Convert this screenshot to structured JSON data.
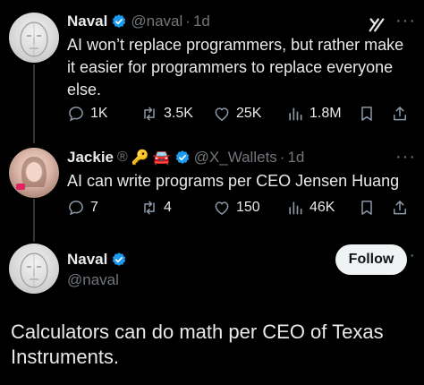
{
  "tweets": [
    {
      "name": "Naval",
      "handle": "@naval",
      "separator": "·",
      "time": "1d",
      "text": "AI won’t replace programmers, but rather make it easier for programmers to replace everyone else.",
      "stats": {
        "replies": "1K",
        "retweets": "3.5K",
        "likes": "25K",
        "views": "1.8M"
      }
    },
    {
      "name": "Jackie",
      "badges": [
        "registered-icon",
        "key-icon",
        "car-icon"
      ],
      "handle": "@X_Wallets",
      "separator": "·",
      "time": "1d",
      "text": "AI can write programs per CEO Jensen Huang",
      "stats": {
        "replies": "7",
        "retweets": "4",
        "likes": "150",
        "views": "46K"
      }
    }
  ],
  "main": {
    "name": "Naval",
    "handle": "@naval",
    "follow_label": "Follow",
    "text": "Calculators can do math per CEO of Texas Instruments."
  },
  "colors": {
    "verified": "#1d9bf0",
    "background": "#000000",
    "muted": "#71767b"
  }
}
